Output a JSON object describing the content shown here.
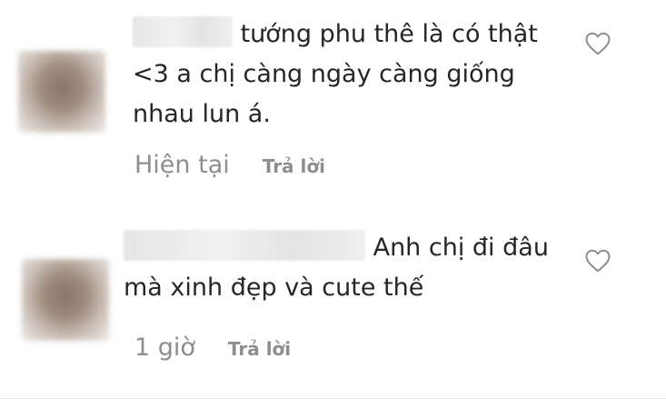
{
  "comments": [
    {
      "text": "tướng phu thê là có thật <3 a chị càng ngày càng giống nhau lun á.",
      "time": "Hiện tại",
      "reply_label": "Trả lời",
      "like_icon": "heart-outline-icon"
    },
    {
      "text": "Anh chị đi đâu mà xinh đẹp và cute thế",
      "time": "1 giờ",
      "reply_label": "Trả lời",
      "like_icon": "heart-outline-icon"
    }
  ],
  "colors": {
    "text": "#262626",
    "secondary": "#8e8e8e",
    "divider": "#e6e6e6"
  }
}
